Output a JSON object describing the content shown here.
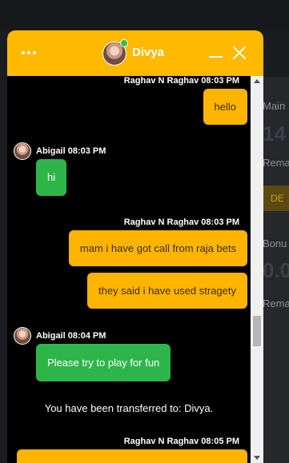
{
  "background": {
    "labels": [
      "Main",
      "Rema",
      "Bonu",
      "Rema"
    ],
    "big_values": [
      "14",
      "0.0"
    ],
    "button": "DE"
  },
  "header": {
    "agent_name": "Divya",
    "menu_icon": "ellipsis-icon",
    "minimize_icon": "minimize-icon",
    "close_icon": "close-icon",
    "accent": "#ffb900",
    "online_color": "#2ebd4d"
  },
  "messages": [
    {
      "sender": "Raghav N Raghav",
      "time": "08:03 PM",
      "text": "hello"
    },
    {
      "sender": "Abigail",
      "time": "08:03 PM",
      "text": "hi"
    },
    {
      "sender": "Raghav N Raghav",
      "time": "08:03 PM",
      "text": "mam i have got call from raja bets"
    },
    {
      "text": "they said i have used stragety"
    },
    {
      "sender": "Abigail",
      "time": "08:04 PM",
      "text": "Please try to play for fun"
    },
    {
      "system": "You have been transferred to: Divya."
    },
    {
      "sender": "Raghav N Raghav",
      "time": "08:05 PM",
      "text": ""
    }
  ],
  "meta": {
    "m0": "Raghav N Raghav 08:03 PM",
    "m1": "Abigail 08:03 PM",
    "m2": "Raghav N Raghav 08:03 PM",
    "m4": "Abigail 08:04 PM",
    "m6": "Raghav N Raghav 08:05 PM"
  }
}
